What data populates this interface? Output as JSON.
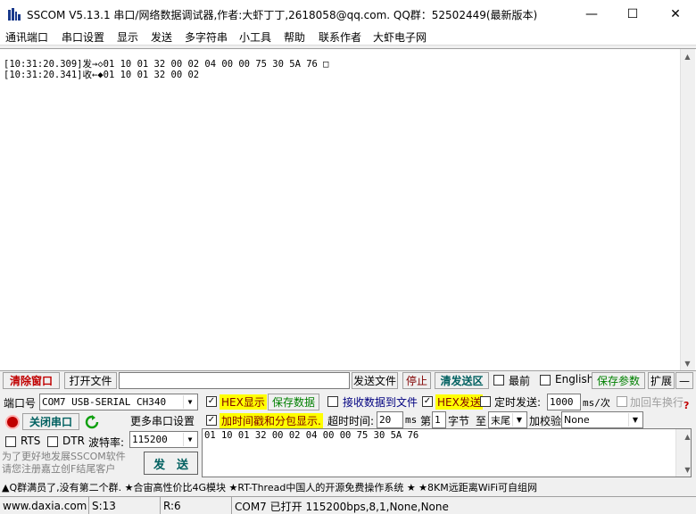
{
  "window": {
    "title": "SSCOM V5.13.1 串口/网络数据调试器,作者:大虾丁丁,2618058@qq.com. QQ群：52502449(最新版本)",
    "app_icon": "sscom-logo-icon",
    "minimize": "—",
    "maximize": "☐",
    "close": "✕"
  },
  "menu": {
    "items": [
      "通讯端口",
      "串口设置",
      "显示",
      "发送",
      "多字符串",
      "小工具",
      "帮助",
      "联系作者",
      "大虾电子网"
    ]
  },
  "receive": {
    "lines": [
      "[10:31:20.309]发→◇01 10 01 32 00 02 04 00 00 75 30 5A 76 □",
      "[10:31:20.341]收←◆01 10 01 32 00 02"
    ]
  },
  "toolbar": {
    "clear_window": "清除窗口",
    "open_file": "打开文件",
    "file_path": "",
    "send_file": "发送文件",
    "stop": "停止",
    "clear_send": "清发送区",
    "topmost": "最前",
    "english": "English",
    "save_params": "保存参数",
    "expand": "扩展",
    "collapse": "—"
  },
  "port": {
    "label": "端口号",
    "value": "COM7 USB-SERIAL CH340",
    "close_port": "关闭串口",
    "refresh_icon": "refresh-icon",
    "more_settings": "更多串口设置",
    "rts": "RTS",
    "dtr": "DTR",
    "baud_label": "波特率:",
    "baud_value": "115200"
  },
  "options": {
    "hex_display": "HEX显示",
    "save_data": "保存数据",
    "recv_to_file": "接收数据到文件",
    "hex_send": "HEX发送",
    "timed_send": "定时发送:",
    "interval": "1000",
    "interval_unit": "ms/次",
    "add_crlf": "加回车换行",
    "help": "?",
    "timestamp": "加时间戳和分包显示.",
    "timeout_label": "超时时间:",
    "timeout_value": "20",
    "timeout_unit": "ms",
    "byte_prefix": "第",
    "byte_value": "1",
    "byte_label": "字节",
    "to_label": "至",
    "tail_value": "末尾",
    "checksum_label": "加校验",
    "checksum_value": "None"
  },
  "send": {
    "data": "01 10 01 32 00 02 04 00 00 75 30 5A 76",
    "send_button": "发　送",
    "promo_note": "为了更好地发展SSCOM软件\n请您注册嘉立创F结尾客户"
  },
  "promo_bar": "▲Q群满员了,没有第二个群. ★合宙高性价比4G模块 ★RT-Thread中国人的开源免费操作系统 ★ ★8KM远距离WiFi可自组网",
  "status": {
    "website": "www.daxia.com",
    "sent": "S:13",
    "received": "R:6",
    "port_state": "COM7 已打开  115200bps,8,1,None,None"
  }
}
